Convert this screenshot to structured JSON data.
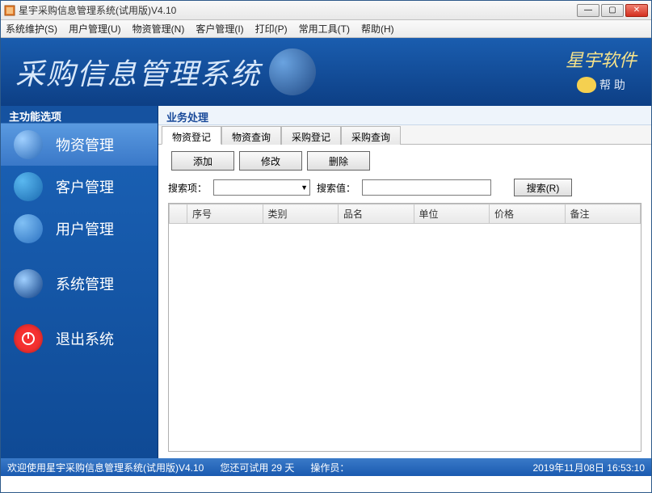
{
  "window": {
    "title": "星宇采购信息管理系统(试用版)V4.10"
  },
  "menus": [
    {
      "label": "系统维护(S)"
    },
    {
      "label": "用户管理(U)"
    },
    {
      "label": "物资管理(N)"
    },
    {
      "label": "客户管理(I)"
    },
    {
      "label": "打印(P)"
    },
    {
      "label": "常用工具(T)"
    },
    {
      "label": "帮助(H)"
    }
  ],
  "banner": {
    "title": "采购信息管理系统",
    "brand": "星宇软件",
    "help": "帮 助"
  },
  "sidebar": {
    "header": "主功能选项",
    "items": [
      {
        "label": "物资管理"
      },
      {
        "label": "客户管理"
      },
      {
        "label": "用户管理"
      },
      {
        "label": "系统管理"
      },
      {
        "label": "退出系统"
      }
    ]
  },
  "main": {
    "header": "业务处理",
    "tabs": [
      {
        "label": "物资登记"
      },
      {
        "label": "物资查询"
      },
      {
        "label": "采购登记"
      },
      {
        "label": "采购查询"
      }
    ],
    "buttons": {
      "add": "添加",
      "edit": "修改",
      "del": "删除"
    },
    "search": {
      "field_label": "搜索项：",
      "value_label": "搜索值：",
      "button": "搜索(R)"
    },
    "columns": [
      "",
      "序号",
      "类别",
      "品名",
      "单位",
      "价格",
      "备注"
    ]
  },
  "status": {
    "welcome": "欢迎使用星宇采购信息管理系统(试用版)V4.10",
    "trial": "您还可试用 29 天",
    "operator_label": "操作员：",
    "datetime": "2019年11月08日 16:53:10"
  }
}
